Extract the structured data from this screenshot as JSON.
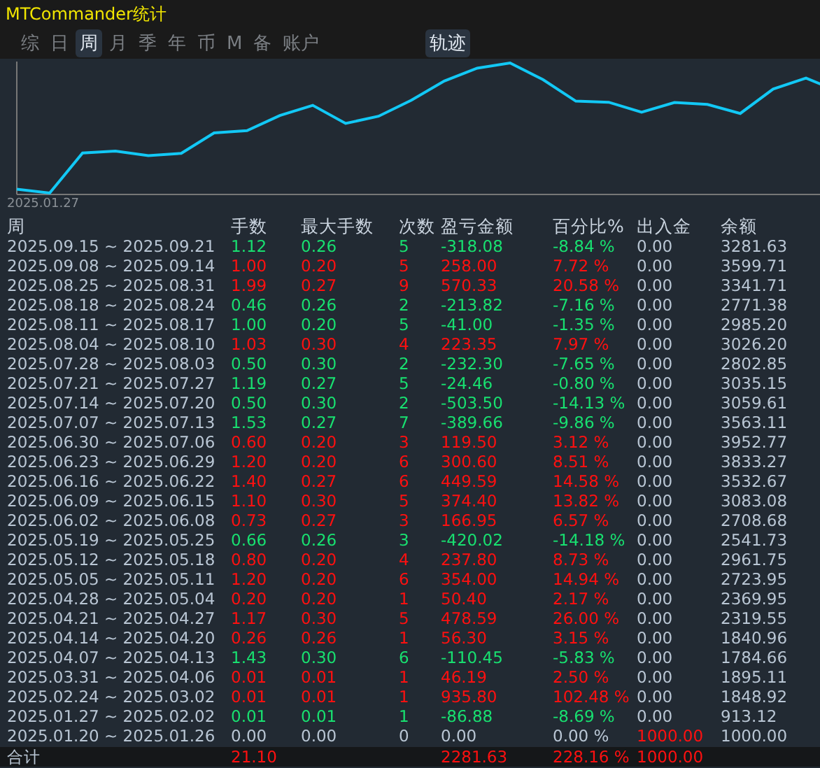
{
  "window": {
    "title": "MTCommander统计"
  },
  "tabs": [
    {
      "label": "综",
      "selected": false
    },
    {
      "label": "日",
      "selected": false
    },
    {
      "label": "周",
      "selected": true
    },
    {
      "label": "月",
      "selected": false
    },
    {
      "label": "季",
      "selected": false
    },
    {
      "label": "年",
      "selected": false
    },
    {
      "label": "币",
      "selected": false
    },
    {
      "label": "M",
      "selected": false
    },
    {
      "label": "备",
      "selected": false
    },
    {
      "label": "账户",
      "selected": false
    }
  ],
  "track_toggle": {
    "label": "轨迹",
    "on": true
  },
  "chart": {
    "start_label": "2025.01.27"
  },
  "table": {
    "columns": [
      "周",
      "手数",
      "最大手数",
      "次数",
      "盈亏金额",
      "百分比%",
      "出入金",
      "余额"
    ],
    "rows": [
      {
        "color": "#18e070",
        "week": "2025.09.15 ~ 2025.09.21",
        "lots": "1.12",
        "max_lots": "0.26",
        "count": "5",
        "pnl": "-318.08",
        "pct": "-8.84 %",
        "cash": "0.00",
        "cash_highlight": false,
        "balance": "3281.63"
      },
      {
        "color": "#ff1010",
        "week": "2025.09.08 ~ 2025.09.14",
        "lots": "1.00",
        "max_lots": "0.20",
        "count": "5",
        "pnl": "258.00",
        "pct": "7.72 %",
        "cash": "0.00",
        "cash_highlight": false,
        "balance": "3599.71"
      },
      {
        "color": "#ff1010",
        "week": "2025.08.25 ~ 2025.08.31",
        "lots": "1.99",
        "max_lots": "0.27",
        "count": "9",
        "pnl": "570.33",
        "pct": "20.58 %",
        "cash": "0.00",
        "cash_highlight": false,
        "balance": "3341.71"
      },
      {
        "color": "#18e070",
        "week": "2025.08.18 ~ 2025.08.24",
        "lots": "0.46",
        "max_lots": "0.26",
        "count": "2",
        "pnl": "-213.82",
        "pct": "-7.16 %",
        "cash": "0.00",
        "cash_highlight": false,
        "balance": "2771.38"
      },
      {
        "color": "#18e070",
        "week": "2025.08.11 ~ 2025.08.17",
        "lots": "1.00",
        "max_lots": "0.20",
        "count": "5",
        "pnl": "-41.00",
        "pct": "-1.35 %",
        "cash": "0.00",
        "cash_highlight": false,
        "balance": "2985.20"
      },
      {
        "color": "#ff1010",
        "week": "2025.08.04 ~ 2025.08.10",
        "lots": "1.03",
        "max_lots": "0.30",
        "count": "4",
        "pnl": "223.35",
        "pct": "7.97 %",
        "cash": "0.00",
        "cash_highlight": false,
        "balance": "3026.20"
      },
      {
        "color": "#18e070",
        "week": "2025.07.28 ~ 2025.08.03",
        "lots": "0.50",
        "max_lots": "0.30",
        "count": "2",
        "pnl": "-232.30",
        "pct": "-7.65 %",
        "cash": "0.00",
        "cash_highlight": false,
        "balance": "2802.85"
      },
      {
        "color": "#18e070",
        "week": "2025.07.21 ~ 2025.07.27",
        "lots": "1.19",
        "max_lots": "0.27",
        "count": "5",
        "pnl": "-24.46",
        "pct": "-0.80 %",
        "cash": "0.00",
        "cash_highlight": false,
        "balance": "3035.15"
      },
      {
        "color": "#18e070",
        "week": "2025.07.14 ~ 2025.07.20",
        "lots": "0.50",
        "max_lots": "0.30",
        "count": "2",
        "pnl": "-503.50",
        "pct": "-14.13 %",
        "cash": "0.00",
        "cash_highlight": false,
        "balance": "3059.61"
      },
      {
        "color": "#18e070",
        "week": "2025.07.07 ~ 2025.07.13",
        "lots": "1.53",
        "max_lots": "0.27",
        "count": "7",
        "pnl": "-389.66",
        "pct": "-9.86 %",
        "cash": "0.00",
        "cash_highlight": false,
        "balance": "3563.11"
      },
      {
        "color": "#ff1010",
        "week": "2025.06.30 ~ 2025.07.06",
        "lots": "0.60",
        "max_lots": "0.20",
        "count": "3",
        "pnl": "119.50",
        "pct": "3.12 %",
        "cash": "0.00",
        "cash_highlight": false,
        "balance": "3952.77"
      },
      {
        "color": "#ff1010",
        "week": "2025.06.23 ~ 2025.06.29",
        "lots": "1.20",
        "max_lots": "0.20",
        "count": "6",
        "pnl": "300.60",
        "pct": "8.51 %",
        "cash": "0.00",
        "cash_highlight": false,
        "balance": "3833.27"
      },
      {
        "color": "#ff1010",
        "week": "2025.06.16 ~ 2025.06.22",
        "lots": "1.40",
        "max_lots": "0.27",
        "count": "6",
        "pnl": "449.59",
        "pct": "14.58 %",
        "cash": "0.00",
        "cash_highlight": false,
        "balance": "3532.67"
      },
      {
        "color": "#ff1010",
        "week": "2025.06.09 ~ 2025.06.15",
        "lots": "1.10",
        "max_lots": "0.30",
        "count": "5",
        "pnl": "374.40",
        "pct": "13.82 %",
        "cash": "0.00",
        "cash_highlight": false,
        "balance": "3083.08"
      },
      {
        "color": "#ff1010",
        "week": "2025.06.02 ~ 2025.06.08",
        "lots": "0.73",
        "max_lots": "0.27",
        "count": "3",
        "pnl": "166.95",
        "pct": "6.57 %",
        "cash": "0.00",
        "cash_highlight": false,
        "balance": "2708.68"
      },
      {
        "color": "#18e070",
        "week": "2025.05.19 ~ 2025.05.25",
        "lots": "0.66",
        "max_lots": "0.26",
        "count": "3",
        "pnl": "-420.02",
        "pct": "-14.18 %",
        "cash": "0.00",
        "cash_highlight": false,
        "balance": "2541.73"
      },
      {
        "color": "#ff1010",
        "week": "2025.05.12 ~ 2025.05.18",
        "lots": "0.80",
        "max_lots": "0.20",
        "count": "4",
        "pnl": "237.80",
        "pct": "8.73 %",
        "cash": "0.00",
        "cash_highlight": false,
        "balance": "2961.75"
      },
      {
        "color": "#ff1010",
        "week": "2025.05.05 ~ 2025.05.11",
        "lots": "1.20",
        "max_lots": "0.20",
        "count": "6",
        "pnl": "354.00",
        "pct": "14.94 %",
        "cash": "0.00",
        "cash_highlight": false,
        "balance": "2723.95"
      },
      {
        "color": "#ff1010",
        "week": "2025.04.28 ~ 2025.05.04",
        "lots": "0.20",
        "max_lots": "0.20",
        "count": "1",
        "pnl": "50.40",
        "pct": "2.17 %",
        "cash": "0.00",
        "cash_highlight": false,
        "balance": "2369.95"
      },
      {
        "color": "#ff1010",
        "week": "2025.04.21 ~ 2025.04.27",
        "lots": "1.17",
        "max_lots": "0.30",
        "count": "5",
        "pnl": "478.59",
        "pct": "26.00 %",
        "cash": "0.00",
        "cash_highlight": false,
        "balance": "2319.55"
      },
      {
        "color": "#ff1010",
        "week": "2025.04.14 ~ 2025.04.20",
        "lots": "0.26",
        "max_lots": "0.26",
        "count": "1",
        "pnl": "56.30",
        "pct": "3.15 %",
        "cash": "0.00",
        "cash_highlight": false,
        "balance": "1840.96"
      },
      {
        "color": "#18e070",
        "week": "2025.04.07 ~ 2025.04.13",
        "lots": "1.43",
        "max_lots": "0.30",
        "count": "6",
        "pnl": "-110.45",
        "pct": "-5.83 %",
        "cash": "0.00",
        "cash_highlight": false,
        "balance": "1784.66"
      },
      {
        "color": "#ff1010",
        "week": "2025.03.31 ~ 2025.04.06",
        "lots": "0.01",
        "max_lots": "0.01",
        "count": "1",
        "pnl": "46.19",
        "pct": "2.50 %",
        "cash": "0.00",
        "cash_highlight": false,
        "balance": "1895.11"
      },
      {
        "color": "#ff1010",
        "week": "2025.02.24 ~ 2025.03.02",
        "lots": "0.01",
        "max_lots": "0.01",
        "count": "1",
        "pnl": "935.80",
        "pct": "102.48 %",
        "cash": "0.00",
        "cash_highlight": false,
        "balance": "1848.92"
      },
      {
        "color": "#18e070",
        "week": "2025.01.27 ~ 2025.02.02",
        "lots": "0.01",
        "max_lots": "0.01",
        "count": "1",
        "pnl": "-86.88",
        "pct": "-8.69 %",
        "cash": "0.00",
        "cash_highlight": false,
        "balance": "913.12"
      },
      {
        "color": "#b9c6d4",
        "week": "2025.01.20 ~ 2025.01.26",
        "lots": "0.00",
        "max_lots": "0.00",
        "count": "0",
        "pnl": "0.00",
        "pct": "0.00 %",
        "cash": "1000.00",
        "cash_highlight": true,
        "balance": "1000.00"
      }
    ],
    "total": {
      "label": "合计",
      "lots": "21.10",
      "pnl": "2281.63",
      "pct": "228.16 %",
      "cash": "1000.00"
    }
  }
}
